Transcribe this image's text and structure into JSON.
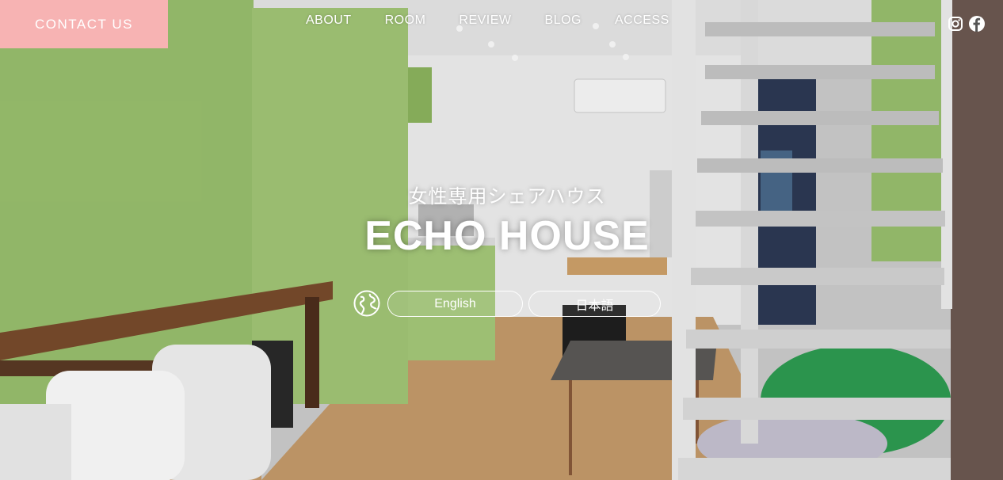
{
  "contact": {
    "label": "CONTACT US"
  },
  "nav": {
    "items": [
      "ABOUT",
      "ROOM",
      "REVIEW",
      "BLOG",
      "ACCESS"
    ]
  },
  "social": {
    "icons": [
      "instagram-icon",
      "facebook-icon"
    ]
  },
  "hero": {
    "subtitle": "女性専用シェアハウス",
    "title": "ECHO HOUSE"
  },
  "language": {
    "icon": "globe-icon",
    "options": [
      "English",
      "日本語"
    ]
  },
  "colors": {
    "contact_bg": "#f7b3b3",
    "wall_green": "#9ac06e",
    "floor": "#c49a6a"
  }
}
